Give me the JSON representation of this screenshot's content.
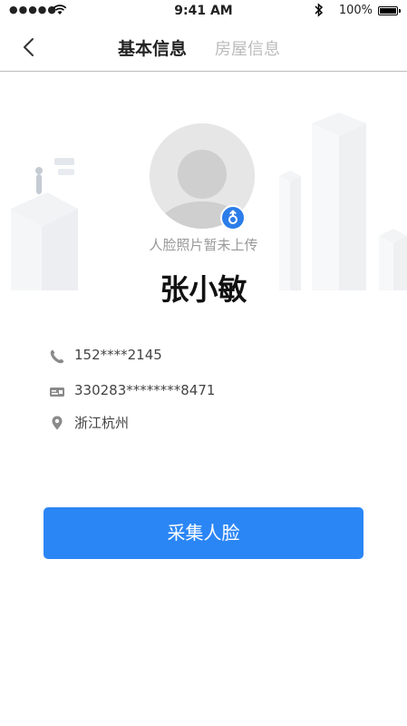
{
  "status_bar": {
    "signal_text": "●●●●●",
    "time": "9:41 AM",
    "battery_percent": "100%"
  },
  "nav": {
    "tabs": [
      {
        "label": "基本信息",
        "active": true
      },
      {
        "label": "房屋信息",
        "active": false
      }
    ]
  },
  "profile": {
    "photo_note": "人脸照片暂未上传",
    "name": "张小敏",
    "phone": "152****2145",
    "id_number": "330283********8471",
    "location": "浙江杭州"
  },
  "actions": {
    "collect_face_label": "采集人脸"
  },
  "colors": {
    "accent": "#2b86f5",
    "badge": "#2b7de9"
  },
  "icons": [
    "back-arrow-icon",
    "wifi-icon",
    "bluetooth-icon",
    "battery-icon",
    "phone-icon",
    "id-card-icon",
    "location-pin-icon",
    "gender-icon",
    "avatar-placeholder-icon"
  ]
}
